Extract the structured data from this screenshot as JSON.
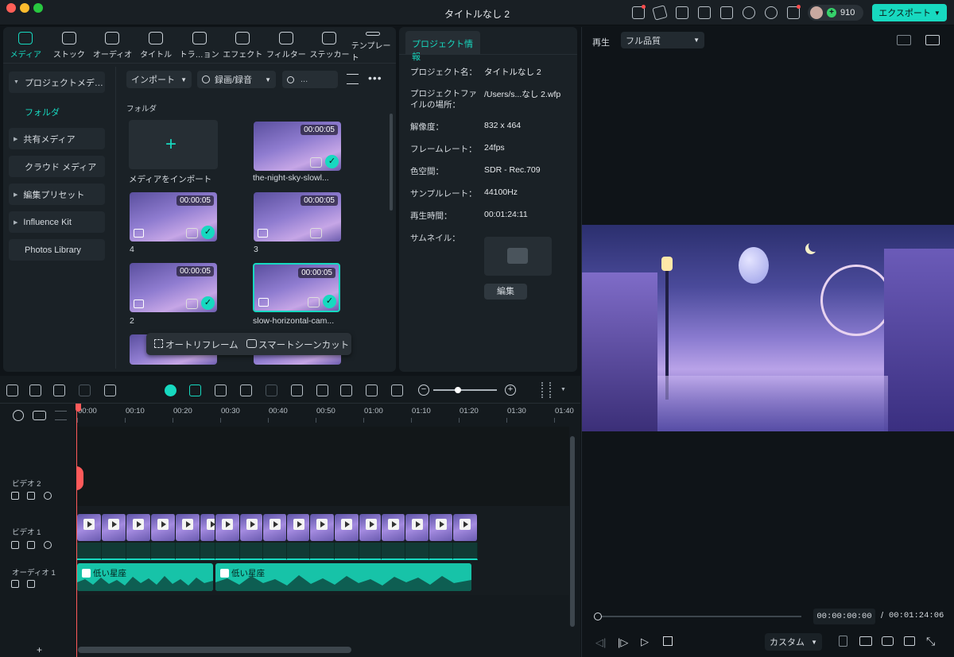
{
  "window": {
    "title": "タイトルなし 2"
  },
  "header": {
    "credits": "910",
    "export_label": "エクスポート"
  },
  "tabs": [
    {
      "label": "メディア",
      "icon": "media-icon",
      "active": true
    },
    {
      "label": "ストック",
      "icon": "stock-icon"
    },
    {
      "label": "オーディオ",
      "icon": "audio-icon"
    },
    {
      "label": "タイトル",
      "icon": "title-icon"
    },
    {
      "label": "トラ…ョン",
      "icon": "transition-icon"
    },
    {
      "label": "エフェクト",
      "icon": "effect-icon"
    },
    {
      "label": "フィルター",
      "icon": "filter-icon"
    },
    {
      "label": "ステッカー",
      "icon": "sticker-icon"
    },
    {
      "label": "テンプレート",
      "icon": "template-icon"
    }
  ],
  "sidebar": {
    "items": [
      {
        "label": "プロジェクトメデ…",
        "expanded": true
      },
      {
        "label": "フォルダ",
        "selected": true
      },
      {
        "label": "共有メディア"
      },
      {
        "label": "クラウド メディア"
      },
      {
        "label": "編集プリセット"
      },
      {
        "label": "Influence Kit"
      },
      {
        "label": "Photos Library"
      }
    ]
  },
  "media": {
    "import_label": "インポート",
    "record_label": "録画/録音",
    "search_placeholder": "...",
    "folder_label": "フォルダ",
    "import_tile_label": "メディアをインポート",
    "items": [
      {
        "name": "the-night-sky-slowl...",
        "duration": "00:00:05"
      },
      {
        "name": "4",
        "duration": "00:00:05"
      },
      {
        "name": "3",
        "duration": "00:00:05"
      },
      {
        "name": "2",
        "duration": "00:00:05"
      },
      {
        "name": "slow-horizontal-cam...",
        "duration": "00:00:05"
      }
    ],
    "popup": {
      "auto_reframe": "オートリフレーム",
      "smart_scene_cut": "スマートシーンカット"
    }
  },
  "project_info": {
    "tab_label": "プロジェクト情報",
    "rows": [
      {
        "label": "プロジェクト名：",
        "value": "タイトルなし 2"
      },
      {
        "label": "プロジェクトファイルの場所：",
        "value": "/Users/s...なし 2.wfp"
      },
      {
        "label": "解像度：",
        "value": "832 x 464"
      },
      {
        "label": "フレームレート：",
        "value": "24fps"
      },
      {
        "label": "色空間：",
        "value": "SDR - Rec.709"
      },
      {
        "label": "サンプルレート：",
        "value": "44100Hz"
      },
      {
        "label": "再生時間：",
        "value": "00:01:24:11"
      }
    ],
    "thumbnail_label": "サムネイル：",
    "edit_label": "編集"
  },
  "preview": {
    "play_label": "再生",
    "quality": "フル品質",
    "current_time": "00:00:00:00",
    "separator": "/",
    "total_time": "00:01:24:06",
    "custom_label": "カスタム"
  },
  "timeline": {
    "ruler": [
      "00:00",
      "00:10",
      "00:20",
      "00:30",
      "00:40",
      "00:50",
      "01:00",
      "01:10",
      "01:20",
      "01:30",
      "01:40"
    ],
    "tracks": {
      "video2": "ビデオ 2",
      "video1": "ビデオ 1",
      "audio1": "オーディオ 1"
    },
    "audio_clips": [
      {
        "name": "低い星座"
      },
      {
        "name": "低い星座"
      }
    ],
    "add_label": "+"
  },
  "colors": {
    "accent": "#17d9c0",
    "playhead": "#ff5a5a",
    "background": "#0f1418",
    "panel": "#1a2126"
  }
}
